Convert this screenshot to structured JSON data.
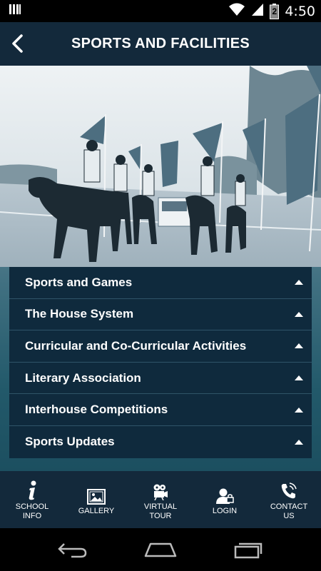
{
  "status_bar": {
    "time": "4:50",
    "battery_level": "2"
  },
  "header": {
    "title": "SPORTS AND FACILITIES"
  },
  "hero_image": {
    "description_icon": "horse-parade-photo"
  },
  "accordion": {
    "items": [
      {
        "label": "Sports and Games"
      },
      {
        "label": "The House System"
      },
      {
        "label": "Curricular and Co-Curricular Activities"
      },
      {
        "label": "Literary Association"
      },
      {
        "label": "Interhouse Competitions"
      },
      {
        "label": "Sports Updates"
      }
    ]
  },
  "bottom_nav": {
    "items": [
      {
        "label": "SCHOOL\nINFO",
        "icon": "info-icon"
      },
      {
        "label": "GALLERY",
        "icon": "gallery-icon"
      },
      {
        "label": "VIRTUAL\nTOUR",
        "icon": "video-camera-icon"
      },
      {
        "label": "LOGIN",
        "icon": "user-login-icon"
      },
      {
        "label": "CONTACT\nUS",
        "icon": "phone-icon"
      }
    ]
  },
  "colors": {
    "header_bg": "#13293b",
    "accordion_bg": "#0f2a3d",
    "accent_teal": "#22596a"
  }
}
